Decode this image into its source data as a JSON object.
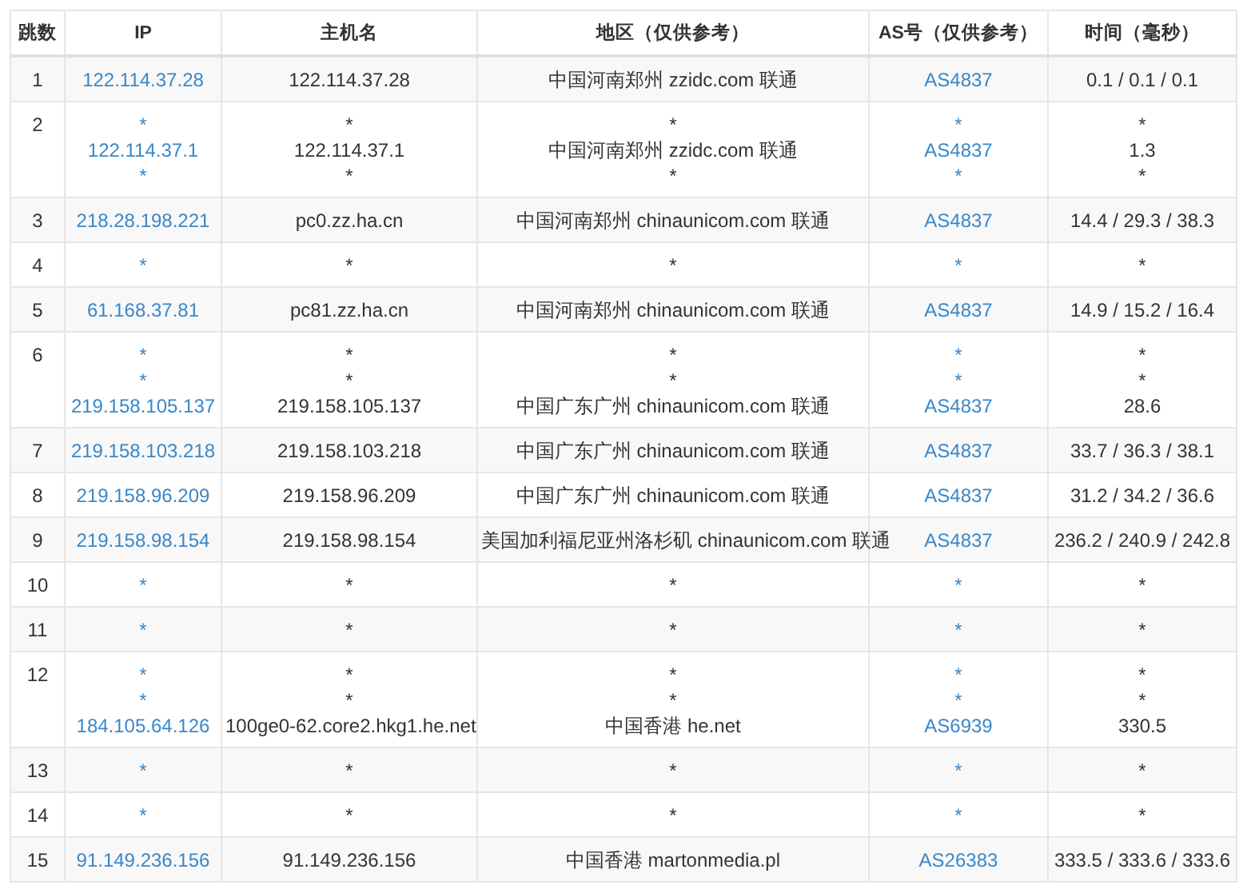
{
  "table": {
    "columns": [
      {
        "label": "跳数",
        "kind": "text"
      },
      {
        "label": "IP",
        "kind": "link"
      },
      {
        "label": "主机名",
        "kind": "text"
      },
      {
        "label": "地区（仅供参考）",
        "kind": "text"
      },
      {
        "label": "AS号（仅供参考）",
        "kind": "link"
      },
      {
        "label": "时间（毫秒）",
        "kind": "text"
      }
    ],
    "rows": [
      {
        "cells": [
          [
            "1"
          ],
          [
            "122.114.37.28"
          ],
          [
            "122.114.37.28"
          ],
          [
            "中国河南郑州 zzidc.com 联通"
          ],
          [
            "AS4837"
          ],
          [
            "0.1 / 0.1 / 0.1"
          ]
        ]
      },
      {
        "cells": [
          [
            "2"
          ],
          [
            "*",
            "122.114.37.1",
            "*"
          ],
          [
            "*",
            "122.114.37.1",
            "*"
          ],
          [
            "*",
            "中国河南郑州 zzidc.com 联通",
            "*"
          ],
          [
            "*",
            "AS4837",
            "*"
          ],
          [
            "*",
            "1.3",
            "*"
          ]
        ]
      },
      {
        "cells": [
          [
            "3"
          ],
          [
            "218.28.198.221"
          ],
          [
            "pc0.zz.ha.cn"
          ],
          [
            "中国河南郑州 chinaunicom.com 联通"
          ],
          [
            "AS4837"
          ],
          [
            "14.4 / 29.3 / 38.3"
          ]
        ]
      },
      {
        "cells": [
          [
            "4"
          ],
          [
            "*"
          ],
          [
            "*"
          ],
          [
            "*"
          ],
          [
            "*"
          ],
          [
            "*"
          ]
        ]
      },
      {
        "cells": [
          [
            "5"
          ],
          [
            "61.168.37.81"
          ],
          [
            "pc81.zz.ha.cn"
          ],
          [
            "中国河南郑州 chinaunicom.com 联通"
          ],
          [
            "AS4837"
          ],
          [
            "14.9 / 15.2 / 16.4"
          ]
        ]
      },
      {
        "cells": [
          [
            "6"
          ],
          [
            "*",
            "*",
            "219.158.105.137"
          ],
          [
            "*",
            "*",
            "219.158.105.137"
          ],
          [
            "*",
            "*",
            "中国广东广州 chinaunicom.com 联通"
          ],
          [
            "*",
            "*",
            "AS4837"
          ],
          [
            "*",
            "*",
            "28.6"
          ]
        ]
      },
      {
        "cells": [
          [
            "7"
          ],
          [
            "219.158.103.218"
          ],
          [
            "219.158.103.218"
          ],
          [
            "中国广东广州 chinaunicom.com 联通"
          ],
          [
            "AS4837"
          ],
          [
            "33.7 / 36.3 / 38.1"
          ]
        ]
      },
      {
        "cells": [
          [
            "8"
          ],
          [
            "219.158.96.209"
          ],
          [
            "219.158.96.209"
          ],
          [
            "中国广东广州 chinaunicom.com 联通"
          ],
          [
            "AS4837"
          ],
          [
            "31.2 / 34.2 / 36.6"
          ]
        ]
      },
      {
        "cells": [
          [
            "9"
          ],
          [
            "219.158.98.154"
          ],
          [
            "219.158.98.154"
          ],
          [
            "美国加利福尼亚州洛杉矶 chinaunicom.com 联通"
          ],
          [
            "AS4837"
          ],
          [
            "236.2 / 240.9 / 242.8"
          ]
        ]
      },
      {
        "cells": [
          [
            "10"
          ],
          [
            "*"
          ],
          [
            "*"
          ],
          [
            "*"
          ],
          [
            "*"
          ],
          [
            "*"
          ]
        ]
      },
      {
        "cells": [
          [
            "11"
          ],
          [
            "*"
          ],
          [
            "*"
          ],
          [
            "*"
          ],
          [
            "*"
          ],
          [
            "*"
          ]
        ]
      },
      {
        "cells": [
          [
            "12"
          ],
          [
            "*",
            "*",
            "184.105.64.126"
          ],
          [
            "*",
            "*",
            "100ge0-62.core2.hkg1.he.net"
          ],
          [
            "*",
            "*",
            "中国香港 he.net"
          ],
          [
            "*",
            "*",
            "AS6939"
          ],
          [
            "*",
            "*",
            "330.5"
          ]
        ]
      },
      {
        "cells": [
          [
            "13"
          ],
          [
            "*"
          ],
          [
            "*"
          ],
          [
            "*"
          ],
          [
            "*"
          ],
          [
            "*"
          ]
        ]
      },
      {
        "cells": [
          [
            "14"
          ],
          [
            "*"
          ],
          [
            "*"
          ],
          [
            "*"
          ],
          [
            "*"
          ],
          [
            "*"
          ]
        ]
      },
      {
        "cells": [
          [
            "15"
          ],
          [
            "91.149.236.156"
          ],
          [
            "91.149.236.156"
          ],
          [
            "中国香港 martonmedia.pl"
          ],
          [
            "AS26383"
          ],
          [
            "333.5 / 333.6 / 333.6"
          ]
        ]
      }
    ]
  }
}
